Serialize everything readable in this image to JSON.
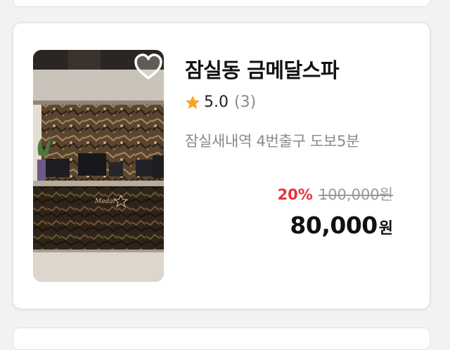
{
  "listing": {
    "title": "잠실동 금메달스파",
    "rating": "5.0",
    "review_count": "(3)",
    "location": "잠실새내역 4번출구 도보5분",
    "discount": "20%",
    "original_price": "100,000원",
    "final_price": "80,000",
    "currency": "원",
    "image_sign_text": "Medal",
    "icons": {
      "wishlist": "heart-icon",
      "rating": "star-icon"
    },
    "colors": {
      "star": "#f5a623",
      "discount": "#e8323c",
      "muted": "#8a8a8e",
      "title": "#111111"
    }
  }
}
